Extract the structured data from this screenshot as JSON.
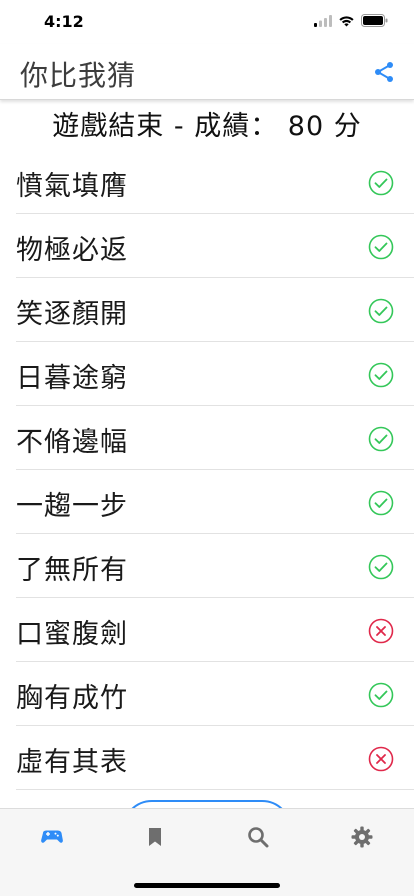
{
  "status_bar": {
    "time": "4:12"
  },
  "header": {
    "title": "你比我猜",
    "share_icon": "share-icon"
  },
  "result": {
    "text": "遊戲結束 - 成績： 80 分"
  },
  "colors": {
    "accent": "#2e8cf7",
    "correct": "#34c759",
    "wrong": "#e0284a"
  },
  "items": [
    {
      "text": "憤氣填膺",
      "status": "correct"
    },
    {
      "text": "物極必返",
      "status": "correct"
    },
    {
      "text": "笑逐顏開",
      "status": "correct"
    },
    {
      "text": "日暮途窮",
      "status": "correct"
    },
    {
      "text": "不脩邊幅",
      "status": "correct"
    },
    {
      "text": "一趨一步",
      "status": "correct"
    },
    {
      "text": "了無所有",
      "status": "correct"
    },
    {
      "text": "口蜜腹劍",
      "status": "wrong"
    },
    {
      "text": "胸有成竹",
      "status": "correct"
    },
    {
      "text": "虛有其表",
      "status": "wrong"
    }
  ],
  "tab_bar": {
    "tabs": [
      {
        "icon": "gamepad-icon",
        "active": true
      },
      {
        "icon": "bookmark-icon",
        "active": false
      },
      {
        "icon": "search-icon",
        "active": false
      },
      {
        "icon": "gear-icon",
        "active": false
      }
    ]
  }
}
